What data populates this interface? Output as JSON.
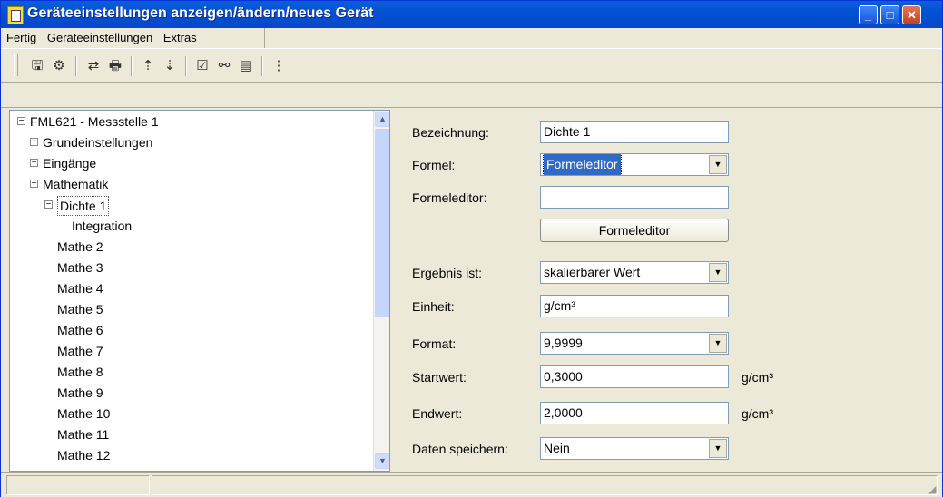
{
  "window": {
    "title": "Geräteeinstellungen anzeigen/ändern/neues Gerät",
    "controls": {
      "minimize": "_",
      "maximize": "□",
      "close": "✕"
    }
  },
  "menu": [
    "Fertig",
    "Geräteeinstellungen",
    "Extras"
  ],
  "toolbar": {
    "icons": [
      "save-icon",
      "device-icon",
      "copy-icon",
      "print-icon",
      "upload-icon",
      "download-icon",
      "properties-icon",
      "network-icon",
      "diagnostics-icon",
      "tree-icon"
    ],
    "glyphs": [
      "🖫",
      "⚙",
      "⇄",
      "🖶",
      "⇡",
      "⇣",
      "☑",
      "⚯",
      "▤",
      "⋮"
    ]
  },
  "tree": {
    "items": [
      {
        "label": "FML621 - Messstelle 1",
        "level": 0,
        "expander": "−"
      },
      {
        "label": "Grundeinstellungen",
        "level": 1,
        "expander": "+"
      },
      {
        "label": "Eingänge",
        "level": 1,
        "expander": "+"
      },
      {
        "label": "Mathematik",
        "level": 1,
        "expander": "−"
      },
      {
        "label": "Dichte 1",
        "level": 2,
        "expander": "−",
        "selected": true
      },
      {
        "label": "Integration",
        "level": 3,
        "expander": ""
      },
      {
        "label": "Mathe 2",
        "level": 2,
        "expander": ""
      },
      {
        "label": "Mathe 3",
        "level": 2,
        "expander": ""
      },
      {
        "label": "Mathe 4",
        "level": 2,
        "expander": ""
      },
      {
        "label": "Mathe 5",
        "level": 2,
        "expander": ""
      },
      {
        "label": "Mathe 6",
        "level": 2,
        "expander": ""
      },
      {
        "label": "Mathe 7",
        "level": 2,
        "expander": ""
      },
      {
        "label": "Mathe 8",
        "level": 2,
        "expander": ""
      },
      {
        "label": "Mathe 9",
        "level": 2,
        "expander": ""
      },
      {
        "label": "Mathe 10",
        "level": 2,
        "expander": ""
      },
      {
        "label": "Mathe 11",
        "level": 2,
        "expander": ""
      },
      {
        "label": "Mathe 12",
        "level": 2,
        "expander": ""
      }
    ]
  },
  "form": {
    "bezeichnung": {
      "label": "Bezeichnung:",
      "value": "Dichte 1"
    },
    "formel": {
      "label": "Formel:",
      "value": "Formeleditor"
    },
    "formeleditor": {
      "label": "Formeleditor:",
      "value": ""
    },
    "formeleditor_button": "Formeleditor",
    "ergebnis": {
      "label": "Ergebnis ist:",
      "value": "skalierbarer Wert"
    },
    "einheit": {
      "label": "Einheit:",
      "value": "g/cm³"
    },
    "format": {
      "label": "Format:",
      "value": "9,9999"
    },
    "startwert": {
      "label": "Startwert:",
      "value": "0,3000",
      "unit": "g/cm³"
    },
    "endwert": {
      "label": "Endwert:",
      "value": "2,0000",
      "unit": "g/cm³"
    },
    "daten": {
      "label": "Daten speichern:",
      "value": "Nein"
    }
  }
}
